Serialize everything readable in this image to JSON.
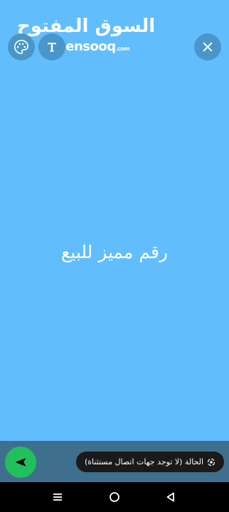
{
  "watermark": {
    "arabic": "السوق المفتوح",
    "latin": "opensooq",
    "latin_suffix": ".com"
  },
  "canvas": {
    "background_color": "#62bdfd",
    "text": "رقم مميز للبيع"
  },
  "toolbar": {
    "palette_icon": "palette-icon",
    "text_style_icon": "text-style-icon",
    "close_icon": "close-icon"
  },
  "footer": {
    "send_icon": "send-icon",
    "send_color": "#22c05c",
    "status_text": "الحالة (لا توجد جهات اتصال مستثناة)",
    "status_icon": "privacy-icon"
  },
  "navigation": {
    "menu_icon": "recent-apps-icon",
    "home_icon": "home-icon",
    "back_icon": "back-icon"
  }
}
